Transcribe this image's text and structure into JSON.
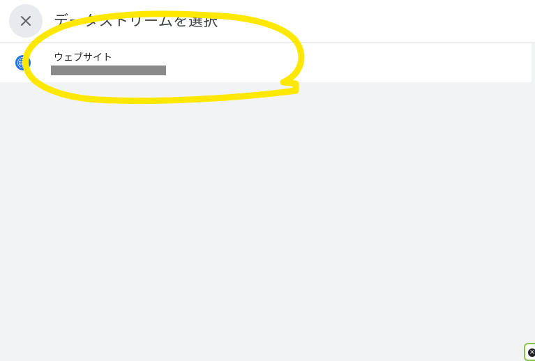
{
  "header": {
    "title": "データストリームを選択",
    "close_icon": "close-icon"
  },
  "streams": [
    {
      "label": "ウェブサイト",
      "icon": "globe-icon",
      "redacted": true
    }
  ],
  "colors": {
    "header_bg": "#ffffff",
    "page_bg": "#f1f3f4",
    "annotation": "#ffe800",
    "globe_ring": "#1a73e8"
  },
  "overlay": {
    "annotation": "yellow-circle-highlight"
  },
  "badge": {
    "symbol": "×"
  }
}
